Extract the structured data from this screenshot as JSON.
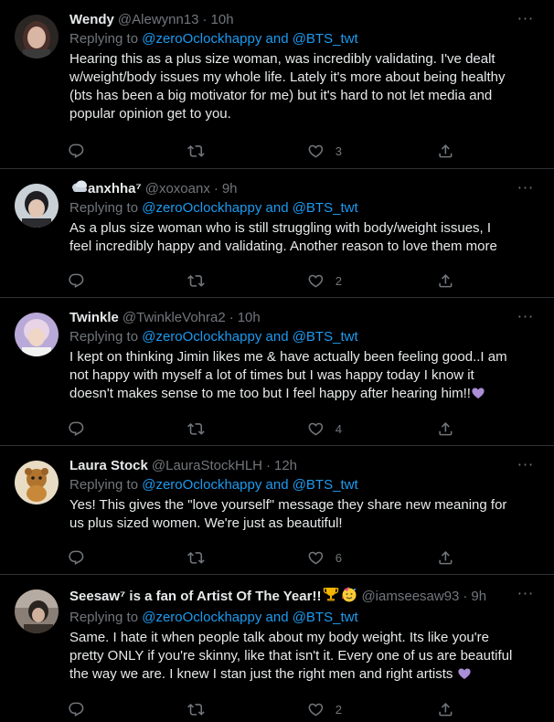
{
  "replying_prefix": "Replying to ",
  "more_icon": "⋅⋅⋅",
  "icons": {
    "reply": "reply-icon",
    "retweet": "retweet-icon",
    "like": "like-icon",
    "share": "share-icon"
  },
  "tweets": [
    {
      "name": "Wendy",
      "handle": "@Alewynn13",
      "time": "10h",
      "replying_to": "@zeroOclockhappy and @BTS_twt",
      "text": "Hearing this as a plus size woman, was incredibly validating. I've dealt w/weight/body issues my whole life. Lately it's more about being healthy (bts has been a big motivator for me) but it's hard to not let media and popular opinion get to you.",
      "likes": "3"
    },
    {
      "name": "anxhha⁷",
      "handle": "@xoxoanx",
      "time": "9h",
      "replying_to": "@zeroOclockhappy and @BTS_twt",
      "text": "As a plus size woman who is still struggling with body/weight issues, I feel incredibly happy and validating. Another reason to love them more",
      "likes": "2"
    },
    {
      "name": "Twinkle",
      "handle": "@TwinkleVohra2",
      "time": "10h",
      "replying_to": "@zeroOclockhappy and @BTS_twt",
      "text": "I kept on thinking Jimin likes me & have actually been feeling good..I am not happy with myself a lot of times but I was happy today I know it doesn't makes sense to me too but I feel happy after hearing him!!",
      "likes": "4"
    },
    {
      "name": "Laura Stock",
      "handle": "@LauraStockHLH",
      "time": "12h",
      "replying_to": "@zeroOclockhappy and @BTS_twt",
      "text": "Yes! This gives the \"love yourself\" message they share new meaning for us plus sized women. We're just as beautiful!",
      "likes": "6"
    },
    {
      "name": "Seesaw⁷ is a fan of Artist Of The Year!!",
      "handle": "@iamseesaw93",
      "time": "9h",
      "replying_to": "@zeroOclockhappy and @BTS_twt",
      "text": "Same. I hate it when people talk about my body weight. Its like you're pretty ONLY if you're skinny, like that isn't it. Every one of us are beautiful the way we are. I knew I stan just the right men and right artists",
      "likes": "2"
    }
  ]
}
